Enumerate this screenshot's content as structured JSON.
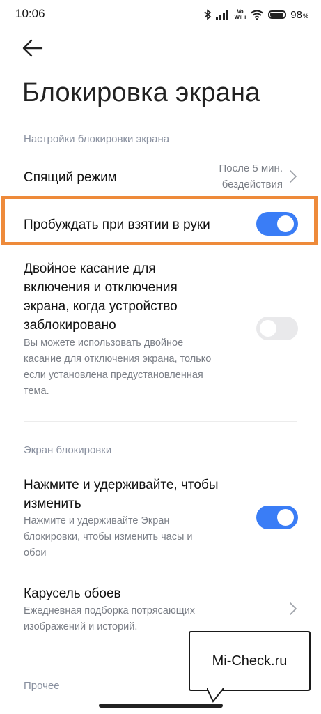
{
  "status_bar": {
    "time": "10:06",
    "vowifi_top": "Vo",
    "vowifi_bottom": "WiFi",
    "battery": "98",
    "battery_unit": "%"
  },
  "header": {
    "title": "Блокировка экрана"
  },
  "section_lock_settings": {
    "title": "Настройки блокировки экрана",
    "sleep": {
      "label": "Спящий режим",
      "value_line1": "После 5 мин.",
      "value_line2": "бездействия"
    },
    "raise_to_wake": {
      "label": "Пробуждать при взятии в руки",
      "enabled": true
    },
    "double_tap": {
      "label_lines": [
        "Двойное касание для",
        "включения и отключения",
        "экрана, когда устройство",
        "заблокировано"
      ],
      "desc_lines": [
        "Вы можете использовать двойное",
        "касание для отключения экрана, только",
        "если установлена предустановленная",
        "тема."
      ],
      "enabled": false
    }
  },
  "section_lock_screen": {
    "title": "Экран блокировки",
    "press_hold": {
      "label_lines": [
        "Нажмите и удерживайте, чтобы",
        "изменить"
      ],
      "desc_lines": [
        "Нажмите и удерживайте Экран",
        "блокировки, чтобы изменить часы и",
        "обои"
      ],
      "enabled": true
    },
    "carousel": {
      "label": "Карусель обоев",
      "desc_lines": [
        "Ежедневная подборка потрясающих",
        "изображений и историй."
      ]
    }
  },
  "section_other": {
    "title": "Прочее"
  },
  "watermark": {
    "text": "Mi-Check.ru"
  },
  "colors": {
    "accent": "#3a7df6",
    "highlight_border": "#ee8a3a",
    "section_title": "#8a91a0"
  },
  "icons": [
    "back-arrow-icon",
    "bluetooth-icon",
    "signal-icon",
    "wifi-icon",
    "battery-icon",
    "chevron-right-icon"
  ]
}
